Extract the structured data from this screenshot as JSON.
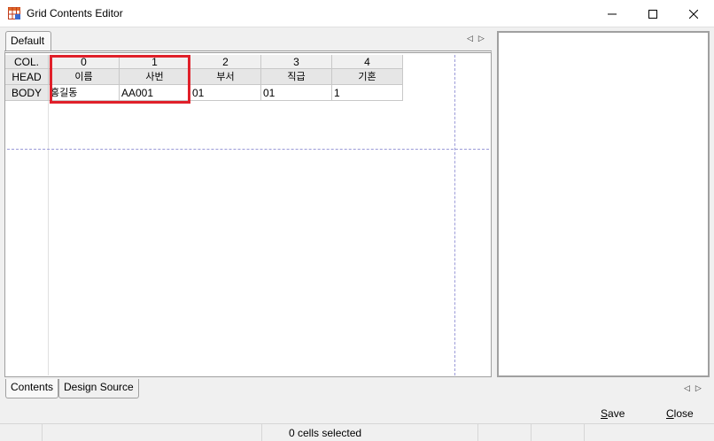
{
  "window": {
    "title": "Grid Contents Editor"
  },
  "tabs": {
    "top": "Default",
    "bottom": [
      "Contents",
      "Design Source"
    ]
  },
  "grid": {
    "row_labels": {
      "col": "COL.",
      "head": "HEAD",
      "body": "BODY"
    },
    "columns": [
      "0",
      "1",
      "2",
      "3",
      "4"
    ],
    "head": [
      "이름",
      "사번",
      "부서",
      "직급",
      "기혼"
    ],
    "body": [
      "홍길동",
      "AA001",
      "01",
      "01",
      "1"
    ]
  },
  "buttons": {
    "save_prefix": "",
    "save_mnemonic": "S",
    "save_rest": "ave",
    "close_mnemonic": "C",
    "close_rest": "lose"
  },
  "status": {
    "text": "0 cells selected"
  },
  "colors": {
    "highlight": "#e0202a",
    "guide_line": "#9a9ad8"
  }
}
